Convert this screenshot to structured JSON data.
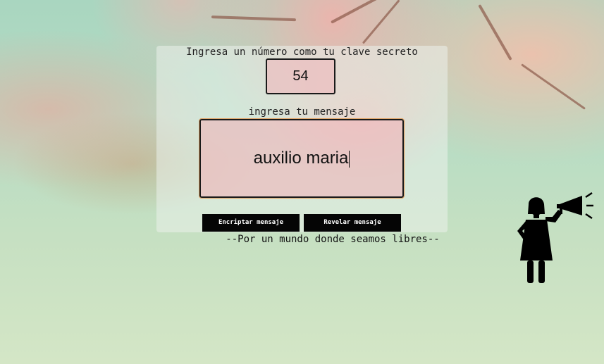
{
  "key_section": {
    "prompt": "Ingresa un número como tu clave secreto",
    "key_value": "54"
  },
  "message_section": {
    "prompt": "ingresa tu mensaje",
    "message_value": "auxilio maria"
  },
  "buttons": {
    "encrypt_label": "Encriptar mensaje",
    "reveal_label": "Revelar mensaje"
  },
  "footer": {
    "tagline": "--Por un mundo donde seamos libres--"
  },
  "illustration": {
    "icon": "woman-megaphone-icon"
  },
  "colors": {
    "button_bg": "#050505",
    "input_bg": "#f0b4b9",
    "background": "#b6dcc4"
  }
}
